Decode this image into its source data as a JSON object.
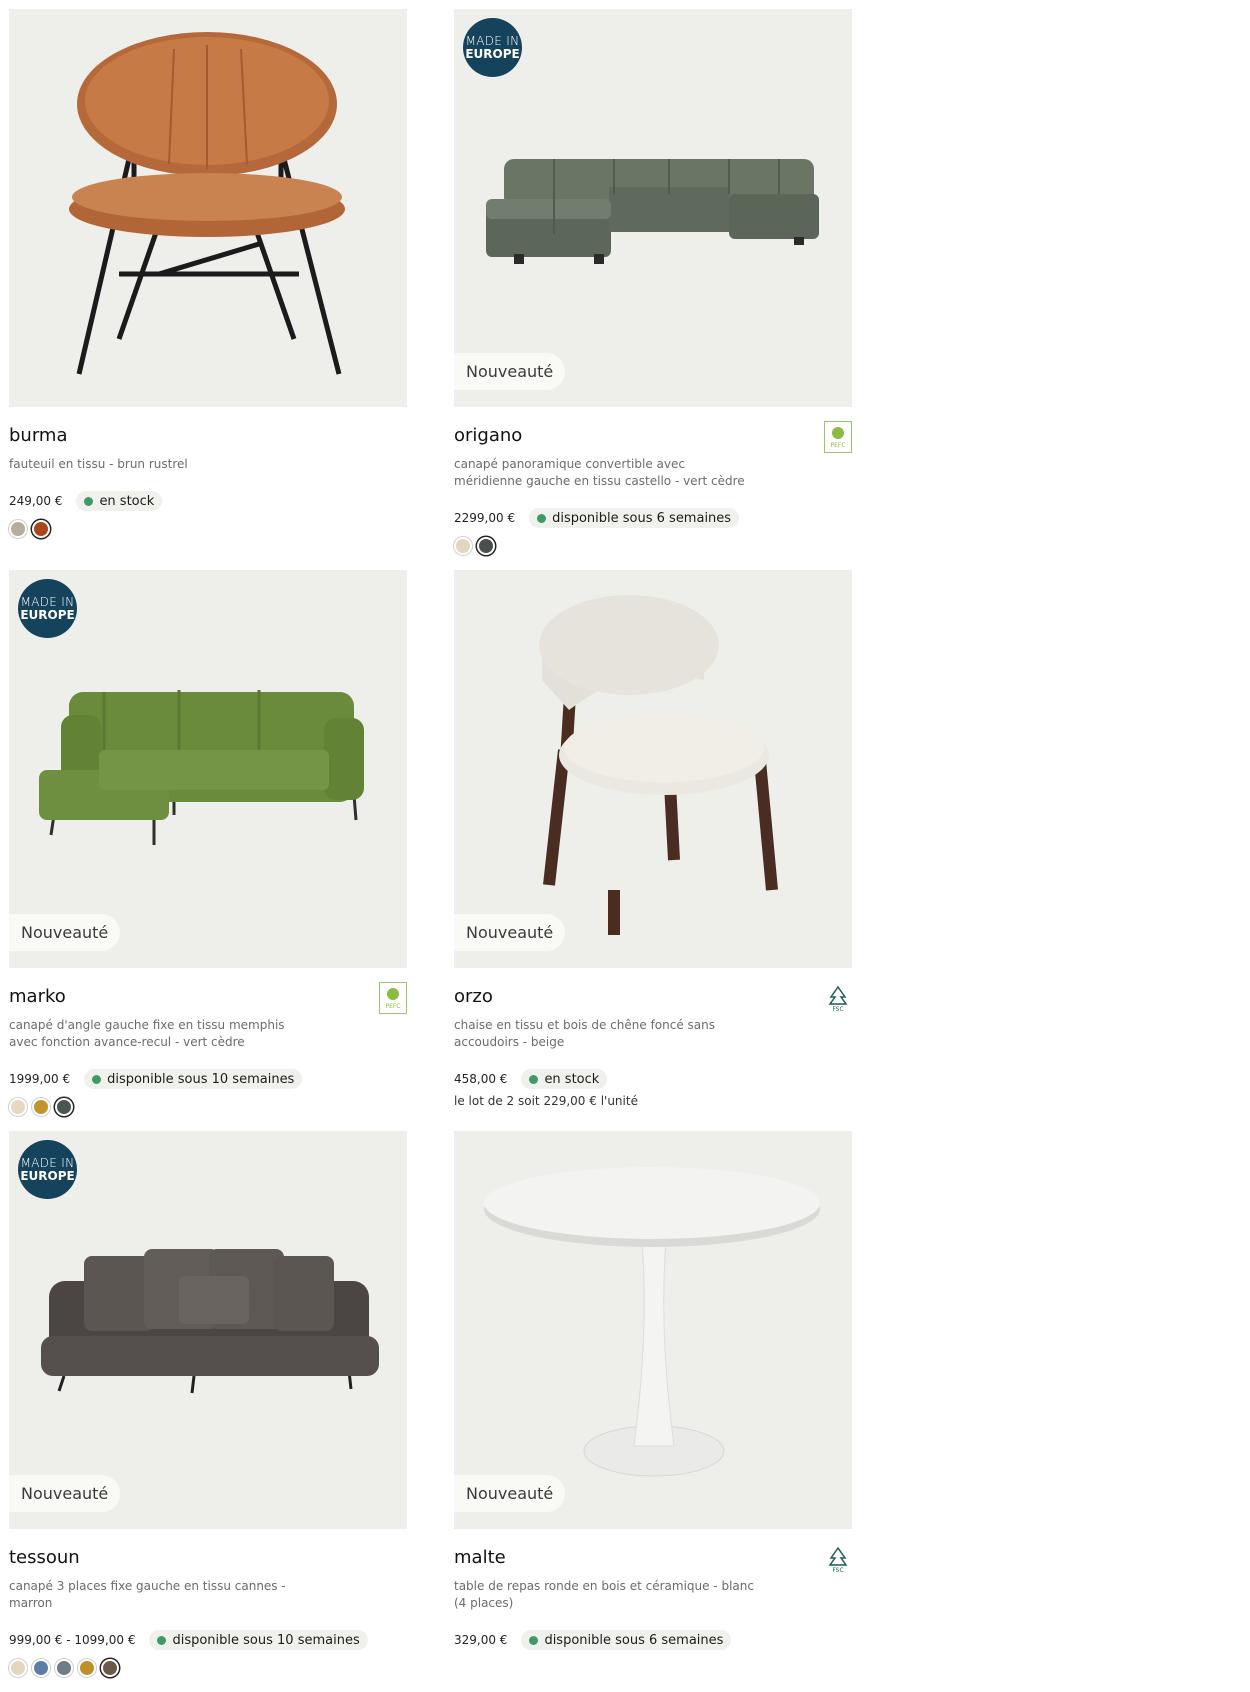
{
  "products": [
    {
      "name": "burma",
      "description": "fauteuil en tissu - brun rustrel",
      "price": "249,00 €",
      "availability": "en stock",
      "swatches": [
        "#b7ad9c",
        "#a9471b"
      ],
      "selected_swatch": 1,
      "badge_europe": false,
      "badge_new": false,
      "cert": ""
    },
    {
      "name": "origano",
      "description": "canapé panoramique convertible avec méridienne gauche en tissu castello - vert cèdre",
      "price": "2299,00 €",
      "availability": "disponible sous 6 semaines",
      "swatches": [
        "#e2d5c1",
        "#4a4f4b"
      ],
      "selected_swatch": 1,
      "badge_europe": true,
      "badge_new": true,
      "cert": "PEFC"
    },
    {
      "name": "marko",
      "description": "canapé d'angle gauche fixe en tissu memphis avec fonction avance-recul - vert cèdre",
      "price": "1999,00 €",
      "availability": "disponible sous 10 semaines",
      "swatches": [
        "#e6d8c2",
        "#c1962f",
        "#4c5650"
      ],
      "selected_swatch": 2,
      "badge_europe": true,
      "badge_new": true,
      "cert": "PEFC"
    },
    {
      "name": "orzo",
      "description": "chaise en tissu et bois de chêne foncé sans accoudoirs - beige",
      "price": "458,00 €",
      "availability": "en stock",
      "lot": "le lot de 2 soit 229,00 € l'unité",
      "swatches": [],
      "badge_europe": false,
      "badge_new": true,
      "cert": "FSC"
    },
    {
      "name": "tessoun",
      "description": "canapé 3 places fixe gauche en tissu cannes - marron",
      "price": "999,00 € - 1099,00 €",
      "availability": "disponible sous 10 semaines",
      "swatches": [
        "#e4d7c2",
        "#5b7ea8",
        "#6f7d86",
        "#c0902d",
        "#6a5a4c"
      ],
      "selected_swatch": 4,
      "badge_europe": true,
      "badge_new": true,
      "cert": ""
    },
    {
      "name": "malte",
      "description": "table de repas ronde en bois et céramique - blanc (4 places)",
      "price": "329,00 €",
      "availability": "disponible sous 6 semaines",
      "swatches": [],
      "badge_europe": false,
      "badge_new": true,
      "cert": "FSC"
    }
  ],
  "labels": {
    "made_in": "MADE IN",
    "europe": "EUROPE",
    "new": "Nouveauté"
  },
  "colors": {
    "stock_dot": "#3f9a6a",
    "europe_badge": "#15435c",
    "card_bg": "#eeefeb"
  }
}
